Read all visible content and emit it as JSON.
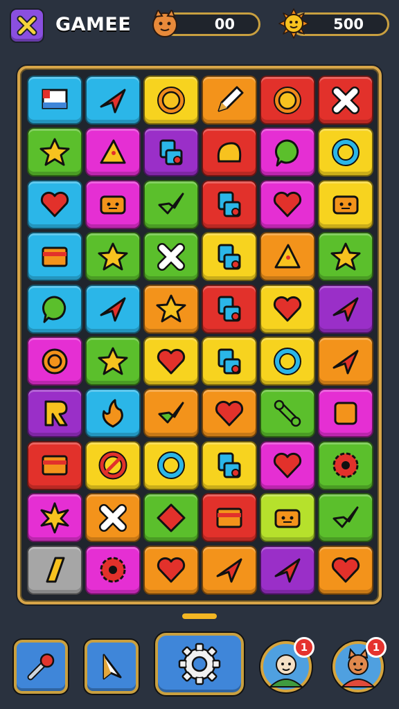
{
  "header": {
    "title": "GAMEE",
    "left_counter": {
      "value": "00",
      "icon": "fox-face-icon"
    },
    "right_counter": {
      "value": "500",
      "icon": "sun-face-icon"
    },
    "close_icon": "close-x-icon"
  },
  "colors": {
    "cyan": "#2bb6e8",
    "red": "#e2312b",
    "yellow": "#f7d31f",
    "orange": "#f3931b",
    "green": "#5bbf2c",
    "magenta": "#e52fd3",
    "purple": "#9a2fc8",
    "gray": "#a6a6a6",
    "lime": "#b6e12c",
    "frame": "#d7a548"
  },
  "board": {
    "rows": [
      [
        {
          "bg": "cyan",
          "icon": "flag"
        },
        {
          "bg": "cyan",
          "icon": "arrow"
        },
        {
          "bg": "yellow",
          "icon": "sun"
        },
        {
          "bg": "orange",
          "icon": "pencil"
        },
        {
          "bg": "red",
          "icon": "sun"
        },
        {
          "bg": "red",
          "icon": "cross"
        }
      ],
      [
        {
          "bg": "green",
          "icon": "star"
        },
        {
          "bg": "magenta",
          "icon": "pizza"
        },
        {
          "bg": "purple",
          "icon": "blocks"
        },
        {
          "bg": "red",
          "icon": "blob"
        },
        {
          "bg": "magenta",
          "icon": "bubble"
        },
        {
          "bg": "yellow",
          "icon": "ring"
        }
      ],
      [
        {
          "bg": "cyan",
          "icon": "heart"
        },
        {
          "bg": "magenta",
          "icon": "robot"
        },
        {
          "bg": "green",
          "icon": "check-arrow"
        },
        {
          "bg": "red",
          "icon": "blocks"
        },
        {
          "bg": "magenta",
          "icon": "heart"
        },
        {
          "bg": "yellow",
          "icon": "robot"
        }
      ],
      [
        {
          "bg": "cyan",
          "icon": "card"
        },
        {
          "bg": "green",
          "icon": "star"
        },
        {
          "bg": "green",
          "icon": "cross"
        },
        {
          "bg": "yellow",
          "icon": "blocks"
        },
        {
          "bg": "orange",
          "icon": "pizza"
        },
        {
          "bg": "green",
          "icon": "star"
        }
      ],
      [
        {
          "bg": "cyan",
          "icon": "bubble"
        },
        {
          "bg": "cyan",
          "icon": "arrow"
        },
        {
          "bg": "orange",
          "icon": "star"
        },
        {
          "bg": "red",
          "icon": "blocks"
        },
        {
          "bg": "yellow",
          "icon": "heart"
        },
        {
          "bg": "purple",
          "icon": "arrow"
        }
      ],
      [
        {
          "bg": "magenta",
          "icon": "target"
        },
        {
          "bg": "green",
          "icon": "star"
        },
        {
          "bg": "yellow",
          "icon": "heart"
        },
        {
          "bg": "yellow",
          "icon": "blocks"
        },
        {
          "bg": "yellow",
          "icon": "ring"
        },
        {
          "bg": "orange",
          "icon": "arrow"
        }
      ],
      [
        {
          "bg": "purple",
          "icon": "letter-r"
        },
        {
          "bg": "cyan",
          "icon": "flame"
        },
        {
          "bg": "orange",
          "icon": "check-arrow"
        },
        {
          "bg": "orange",
          "icon": "heart"
        },
        {
          "bg": "green",
          "icon": "bone"
        },
        {
          "bg": "magenta",
          "icon": "square"
        }
      ],
      [
        {
          "bg": "red",
          "icon": "card"
        },
        {
          "bg": "yellow",
          "icon": "no-sign"
        },
        {
          "bg": "yellow",
          "icon": "ring"
        },
        {
          "bg": "yellow",
          "icon": "blocks"
        },
        {
          "bg": "magenta",
          "icon": "heart"
        },
        {
          "bg": "green",
          "icon": "gear"
        }
      ],
      [
        {
          "bg": "magenta",
          "icon": "burst"
        },
        {
          "bg": "orange",
          "icon": "cross"
        },
        {
          "bg": "green",
          "icon": "diamond"
        },
        {
          "bg": "red",
          "icon": "card"
        },
        {
          "bg": "lime",
          "icon": "robot"
        },
        {
          "bg": "green",
          "icon": "check-arrow"
        }
      ],
      [
        {
          "bg": "gray",
          "icon": "slash"
        },
        {
          "bg": "magenta",
          "icon": "gear"
        },
        {
          "bg": "orange",
          "icon": "heart"
        },
        {
          "bg": "orange",
          "icon": "arrow"
        },
        {
          "bg": "purple",
          "icon": "arrow"
        },
        {
          "bg": "orange",
          "icon": "heart"
        }
      ]
    ]
  },
  "footer": {
    "buttons": [
      {
        "name": "hammer-tool-button",
        "icon": "hammer-icon"
      },
      {
        "name": "shuffle-tool-button",
        "icon": "cursor-icon"
      },
      {
        "name": "settings-button",
        "icon": "gear-icon"
      }
    ],
    "friends": [
      {
        "name": "friend-avatar-1",
        "badge": "1",
        "face": "#f4e0c6",
        "accent": "#3f9b3f"
      },
      {
        "name": "friend-avatar-2",
        "badge": "1",
        "face": "#e0894d",
        "accent": "#e04a3a"
      }
    ]
  }
}
